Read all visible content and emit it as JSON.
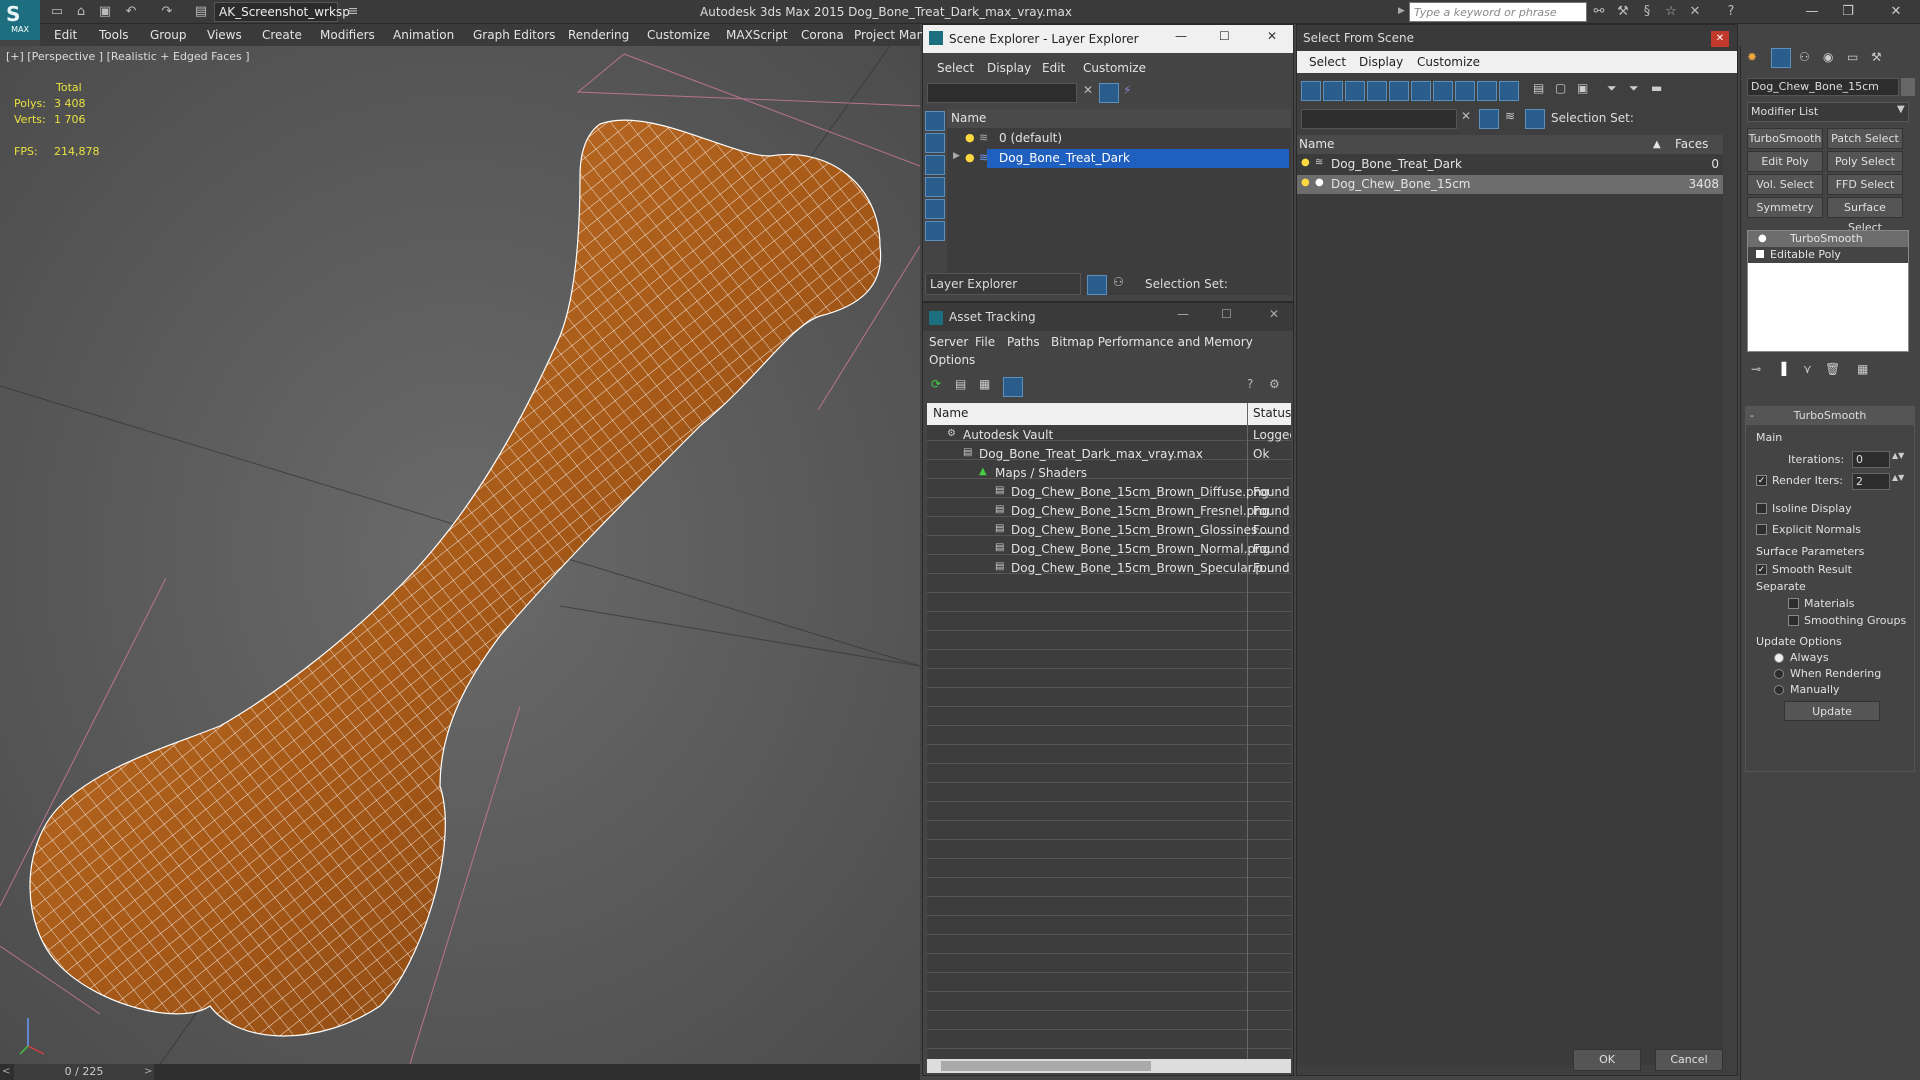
{
  "app": {
    "title": "Autodesk 3ds Max  2015    Dog_Bone_Treat_Dark_max_vray.max",
    "logo": "MAX",
    "workspace": "AK_Screenshot_wrksp",
    "search_placeholder": "Type a keyword or phrase"
  },
  "menus": [
    "Edit",
    "Tools",
    "Group",
    "Views",
    "Create",
    "Modifiers",
    "Animation",
    "Graph Editors",
    "Rendering",
    "Customize",
    "MAXScript",
    "Corona",
    "Project Man"
  ],
  "viewport": {
    "label": "[+] [Perspective ] [Realistic + Edged Faces ]",
    "stats": {
      "total_label": "Total",
      "polys_label": "Polys:",
      "polys": "3 408",
      "verts_label": "Verts:",
      "verts": "1 706",
      "fps_label": "FPS:",
      "fps": "214,878"
    },
    "timeline": "0 / 225"
  },
  "scene_explorer": {
    "title": "Scene Explorer - Layer Explorer",
    "menus": [
      "Select",
      "Display",
      "Edit",
      "Customize"
    ],
    "col_name": "Name",
    "rows": [
      "0 (default)",
      "Dog_Bone_Treat_Dark"
    ],
    "footer_dropdown": "Layer Explorer",
    "selection_set": "Selection Set:"
  },
  "asset_tracking": {
    "title": "Asset Tracking",
    "menus": [
      "Server",
      "File",
      "Paths",
      "Bitmap Performance and Memory",
      "Options"
    ],
    "col_name": "Name",
    "col_status": "Status",
    "rows": [
      {
        "name": "Autodesk Vault",
        "status": "Logged",
        "indent": 0
      },
      {
        "name": "Dog_Bone_Treat_Dark_max_vray.max",
        "status": "Ok",
        "indent": 1
      },
      {
        "name": "Maps / Shaders",
        "status": "",
        "indent": 2
      },
      {
        "name": "Dog_Chew_Bone_15cm_Brown_Diffuse.png",
        "status": "Found",
        "indent": 3
      },
      {
        "name": "Dog_Chew_Bone_15cm_Brown_Fresnel.png",
        "status": "Found",
        "indent": 3
      },
      {
        "name": "Dog_Chew_Bone_15cm_Brown_Glossines....",
        "status": "Found",
        "indent": 3
      },
      {
        "name": "Dog_Chew_Bone_15cm_Brown_Normal.png",
        "status": "Found",
        "indent": 3
      },
      {
        "name": "Dog_Chew_Bone_15cm_Brown_Specular.p...",
        "status": "Found",
        "indent": 3
      }
    ]
  },
  "select_from_scene": {
    "title": "Select From Scene",
    "menus": [
      "Select",
      "Display",
      "Customize"
    ],
    "selection_set": "Selection Set:",
    "col_name": "Name",
    "col_faces": "Faces",
    "rows": [
      {
        "name": "Dog_Bone_Treat_Dark",
        "faces": "0"
      },
      {
        "name": "Dog_Chew_Bone_15cm",
        "faces": "3408"
      }
    ],
    "ok": "OK",
    "cancel": "Cancel"
  },
  "command_panel": {
    "object_name": "Dog_Chew_Bone_15cm",
    "modifier_list": "Modifier List",
    "buttons": [
      "TurboSmooth",
      "Patch Select",
      "Edit Poly",
      "Poly Select",
      "Vol. Select",
      "FFD Select",
      "Symmetry",
      "Surface Select"
    ],
    "stack": [
      "TurboSmooth",
      "Editable Poly"
    ],
    "rollout_title": "TurboSmooth",
    "main_label": "Main",
    "iterations_label": "Iterations:",
    "iterations": "0",
    "render_iters_label": "Render Iters:",
    "render_iters": "2",
    "isoline": "Isoline Display",
    "explicit_normals": "Explicit Normals",
    "surface_params": "Surface Parameters",
    "smooth_result": "Smooth Result",
    "separate": "Separate",
    "materials": "Materials",
    "smoothing_groups": "Smoothing Groups",
    "update_options": "Update Options",
    "always": "Always",
    "when_rendering": "When Rendering",
    "manually": "Manually",
    "update": "Update"
  },
  "colors": {
    "accent": "#1f5fbf",
    "selection": "#1f5fbf",
    "bone": "#b8651e",
    "wire": "#ffffff"
  }
}
